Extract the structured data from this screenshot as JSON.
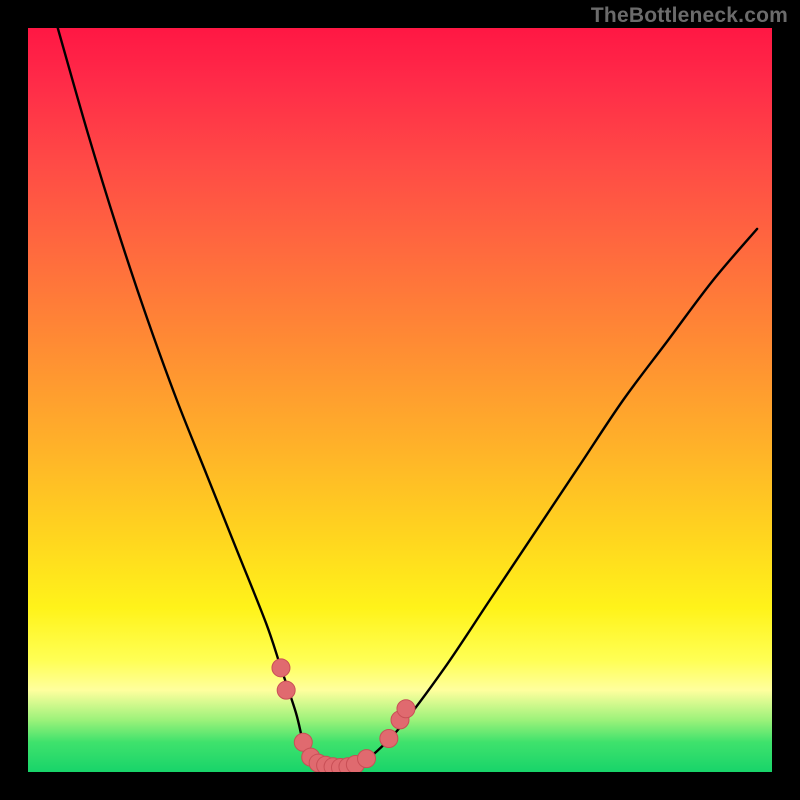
{
  "watermark": "TheBottleneck.com",
  "colors": {
    "background": "#000000",
    "gradient_top": "#ff1744",
    "gradient_mid1": "#ff8a34",
    "gradient_mid2": "#fff31a",
    "gradient_bottom": "#18d46a",
    "curve_stroke": "#000000",
    "marker_fill": "#e06a6f",
    "marker_stroke": "#c94f56"
  },
  "chart_data": {
    "type": "line",
    "title": "",
    "xlabel": "",
    "ylabel": "",
    "xlim": [
      0,
      100
    ],
    "ylim": [
      0,
      100
    ],
    "grid": false,
    "legend": false,
    "series": [
      {
        "name": "bottleneck-curve",
        "x": [
          4,
          8,
          12,
          16,
          20,
          24,
          28,
          32,
          34,
          36,
          37,
          38,
          40,
          42,
          44,
          46,
          50,
          56,
          62,
          68,
          74,
          80,
          86,
          92,
          98
        ],
        "y": [
          100,
          86,
          73,
          61,
          50,
          40,
          30,
          20,
          14,
          8,
          4,
          2,
          0.8,
          0.6,
          0.8,
          2,
          6,
          14,
          23,
          32,
          41,
          50,
          58,
          66,
          73
        ]
      }
    ],
    "markers": [
      {
        "x": 34.0,
        "y": 14
      },
      {
        "x": 34.7,
        "y": 11
      },
      {
        "x": 37.0,
        "y": 4
      },
      {
        "x": 38.0,
        "y": 2.0
      },
      {
        "x": 39.0,
        "y": 1.2
      },
      {
        "x": 40.0,
        "y": 0.9
      },
      {
        "x": 41.0,
        "y": 0.7
      },
      {
        "x": 42.0,
        "y": 0.6
      },
      {
        "x": 43.0,
        "y": 0.7
      },
      {
        "x": 44.0,
        "y": 1.0
      },
      {
        "x": 45.5,
        "y": 1.8
      },
      {
        "x": 48.5,
        "y": 4.5
      },
      {
        "x": 50.0,
        "y": 7.0
      },
      {
        "x": 50.8,
        "y": 8.5
      }
    ]
  }
}
